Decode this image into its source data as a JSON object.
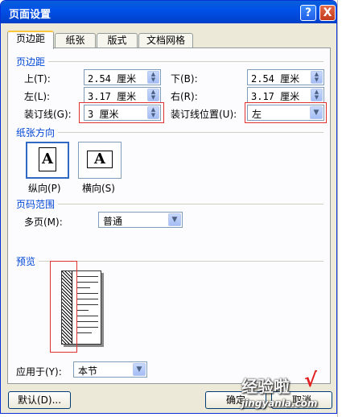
{
  "dialog": {
    "title": "页面设置",
    "help_glyph": "?",
    "close_glyph": "X"
  },
  "tabs": [
    {
      "label": "页边距",
      "active": true
    },
    {
      "label": "纸张",
      "active": false
    },
    {
      "label": "版式",
      "active": false
    },
    {
      "label": "文档网格",
      "active": false
    }
  ],
  "margins": {
    "group_label": "页边距",
    "top": {
      "label": "上(T):",
      "value": "2.54 厘米"
    },
    "bottom": {
      "label": "下(B):",
      "value": "2.54 厘米"
    },
    "left": {
      "label": "左(L):",
      "value": "3.17 厘米"
    },
    "right": {
      "label": "右(R):",
      "value": "3.17 厘米"
    },
    "gutter": {
      "label": "装订线(G):",
      "value": "3 厘米"
    },
    "gutter_position": {
      "label": "装订线位置(U):",
      "value": "左"
    }
  },
  "orientation": {
    "group_label": "纸张方向",
    "icon_glyph": "A",
    "portrait_label": "纵向(P)",
    "landscape_label": "横向(S)",
    "selected": "portrait"
  },
  "pages": {
    "group_label": "页码范围",
    "multiple_label": "多页(M):",
    "multiple_value": "普通"
  },
  "preview": {
    "group_label": "预览",
    "apply_label": "应用于(Y):",
    "apply_value": "本节"
  },
  "buttons": {
    "default": "默认(D)...",
    "ok": "确定",
    "cancel": "取消"
  },
  "watermark": {
    "text": "经验啦",
    "check": "√",
    "url": "jingyanla.com"
  },
  "colors": {
    "title_bar": "#0050e8",
    "group_label": "#0046d5",
    "highlight": "#e03030"
  }
}
